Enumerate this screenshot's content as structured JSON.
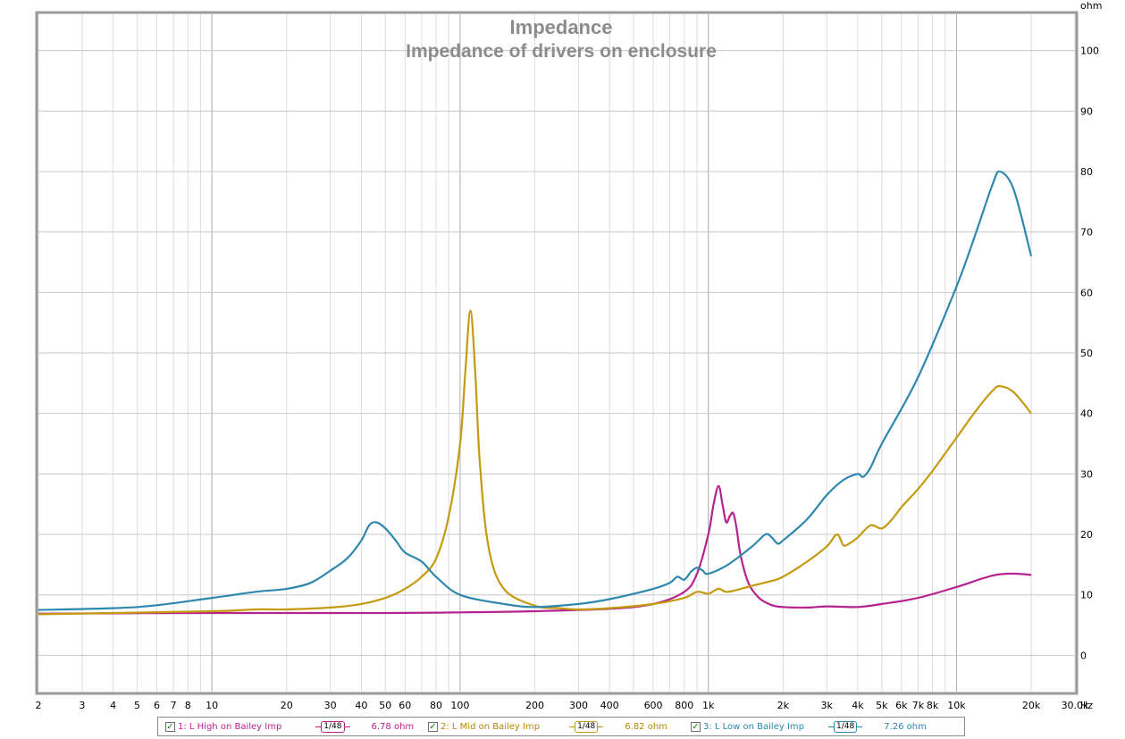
{
  "chart_data": {
    "type": "line",
    "title": "Impedance",
    "subtitle": "Impedance of drivers on enclosure",
    "y_unit": "ohm",
    "x_unit": "Hz",
    "x_scale": "log",
    "xlim": [
      2,
      30000
    ],
    "ylim": [
      -6,
      106
    ],
    "x_ticks": [
      2,
      3,
      4,
      5,
      6,
      7,
      8,
      10,
      20,
      30,
      40,
      50,
      60,
      80,
      100,
      200,
      300,
      400,
      600,
      800,
      1000,
      2000,
      3000,
      4000,
      5000,
      6000,
      7000,
      8000,
      10000,
      20000,
      30000
    ],
    "x_tick_labels": [
      "2",
      "3",
      "4",
      "5",
      "6",
      "7",
      "8",
      "10",
      "20",
      "30",
      "40",
      "50",
      "60",
      "80",
      "100",
      "200",
      "300",
      "400",
      "600",
      "800",
      "1k",
      "2k",
      "3k",
      "4k",
      "5k",
      "6k",
      "7k",
      "8k",
      "10k",
      "20k",
      "30.0k"
    ],
    "y_ticks": [
      0,
      10,
      20,
      30,
      40,
      50,
      60,
      70,
      80,
      90,
      100
    ],
    "grid": true,
    "legend_position": "bottom",
    "series": [
      {
        "name": "1: L High on Bailey Imp",
        "color": "#b5238f",
        "smoothing": "1/48",
        "value_label": "6.78 ohm",
        "x": [
          2,
          10,
          50,
          100,
          200,
          400,
          600,
          800,
          900,
          1000,
          1050,
          1100,
          1140,
          1180,
          1220,
          1260,
          1300,
          1350,
          1450,
          1600,
          1800,
          2000,
          2500,
          3000,
          4000,
          5000,
          7000,
          10000,
          14000,
          17000,
          20000
        ],
        "y": [
          6.9,
          7.0,
          7.0,
          7.1,
          7.3,
          7.7,
          8.5,
          10.5,
          13.5,
          20,
          25,
          28,
          25,
          22,
          23,
          23.5,
          21,
          16.5,
          12,
          9.5,
          8.3,
          8.0,
          7.9,
          8.1,
          8.0,
          8.5,
          9.5,
          11.3,
          13.2,
          13.5,
          13.3
        ]
      },
      {
        "name": "2: L Mid on Bailey Imp",
        "color": "#c49a10",
        "smoothing": "1/48",
        "value_label": "6.82 ohm",
        "x": [
          2,
          10,
          15,
          20,
          30,
          40,
          50,
          60,
          70,
          80,
          90,
          100,
          105,
          110,
          115,
          120,
          130,
          150,
          200,
          250,
          300,
          400,
          600,
          800,
          900,
          1000,
          1100,
          1200,
          1500,
          1800,
          2000,
          2500,
          3000,
          3300,
          3500,
          3700,
          4000,
          4500,
          5000,
          5500,
          6000,
          7000,
          8000,
          10000,
          12000,
          14000,
          15000,
          17000,
          20000
        ],
        "y": [
          6.8,
          7.3,
          7.6,
          7.6,
          7.9,
          8.5,
          9.5,
          11,
          13,
          16,
          23,
          35,
          47,
          57,
          47,
          32,
          18,
          11,
          8.2,
          7.8,
          7.6,
          7.8,
          8.5,
          9.5,
          10.5,
          10.2,
          11,
          10.5,
          11.5,
          12.3,
          13,
          15.5,
          18,
          20,
          18.2,
          18.5,
          19.5,
          21.5,
          21,
          22.5,
          24.5,
          27.5,
          30.5,
          36,
          40.5,
          43.8,
          44.5,
          43.5,
          40
        ]
      },
      {
        "name": "3: L Low on Bailey Imp",
        "color": "#2e87ad",
        "smoothing": "1/48",
        "value_label": "7.26 ohm",
        "x": [
          2,
          5,
          10,
          15,
          20,
          25,
          30,
          35,
          40,
          43,
          46,
          50,
          55,
          60,
          70,
          80,
          100,
          150,
          200,
          300,
          400,
          600,
          700,
          750,
          800,
          850,
          900,
          950,
          1000,
          1200,
          1500,
          1700,
          1800,
          1900,
          2000,
          2500,
          3000,
          3500,
          4000,
          4200,
          4500,
          5000,
          7000,
          10000,
          12000,
          14000,
          15000,
          17000,
          20000
        ],
        "y": [
          7.5,
          8.0,
          9.5,
          10.5,
          11,
          12,
          14,
          16,
          19,
          21.5,
          22,
          21,
          19,
          17,
          15.5,
          13,
          10,
          8.5,
          8,
          8.5,
          9.3,
          11,
          12,
          13,
          12.5,
          13.8,
          14.5,
          14,
          13.5,
          15,
          18,
          20,
          19.5,
          18.5,
          19,
          22.5,
          26.5,
          29,
          30,
          29.5,
          31,
          35,
          46,
          61,
          70,
          78,
          80,
          77,
          66
        ]
      }
    ]
  }
}
